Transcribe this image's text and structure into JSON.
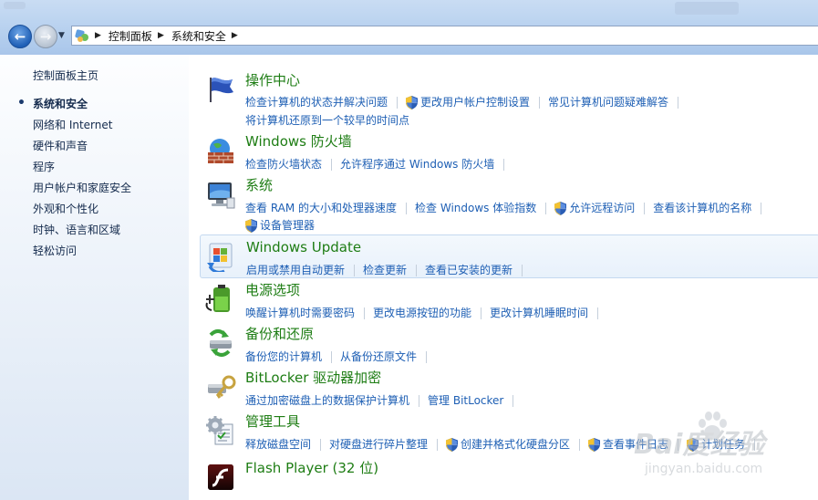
{
  "nav": {
    "back_icon": "back-arrow-icon",
    "forward_icon": "forward-arrow-icon",
    "breadcrumb": [
      "控制面板",
      "系统和安全"
    ]
  },
  "sidebar": {
    "home": "控制面板主页",
    "items": [
      {
        "label": "系统和安全",
        "current": true
      },
      {
        "label": "网络和 Internet"
      },
      {
        "label": "硬件和声音"
      },
      {
        "label": "程序"
      },
      {
        "label": "用户帐户和家庭安全"
      },
      {
        "label": "外观和个性化"
      },
      {
        "label": "时钟、语言和区域"
      },
      {
        "label": "轻松访问"
      }
    ]
  },
  "categories": [
    {
      "title": "操作中心",
      "icon": "flag-icon",
      "rows": [
        [
          {
            "text": "检查计算机的状态并解决问题"
          },
          {
            "text": "更改用户帐户控制设置",
            "shield": true
          },
          {
            "text": "常见计算机问题疑难解答"
          }
        ],
        [
          {
            "text": "将计算机还原到一个较早的时间点"
          }
        ]
      ]
    },
    {
      "title": "Windows 防火墙",
      "icon": "firewall-icon",
      "rows": [
        [
          {
            "text": "检查防火墙状态"
          },
          {
            "text": "允许程序通过 Windows 防火墙"
          }
        ]
      ]
    },
    {
      "title": "系统",
      "icon": "computer-icon",
      "rows": [
        [
          {
            "text": "查看 RAM 的大小和处理器速度"
          },
          {
            "text": "检查 Windows 体验指数"
          },
          {
            "text": "允许远程访问",
            "shield": true
          },
          {
            "text": "查看该计算机的名称"
          }
        ],
        [
          {
            "text": "设备管理器",
            "shield": true
          }
        ]
      ]
    },
    {
      "title": "Windows Update",
      "icon": "windows-update-icon",
      "highlighted": true,
      "rows": [
        [
          {
            "text": "启用或禁用自动更新"
          },
          {
            "text": "检查更新"
          },
          {
            "text": "查看已安装的更新"
          }
        ]
      ]
    },
    {
      "title": "电源选项",
      "icon": "power-battery-icon",
      "rows": [
        [
          {
            "text": "唤醒计算机时需要密码"
          },
          {
            "text": "更改电源按钮的功能"
          },
          {
            "text": "更改计算机睡眠时间"
          }
        ]
      ]
    },
    {
      "title": "备份和还原",
      "icon": "backup-icon",
      "rows": [
        [
          {
            "text": "备份您的计算机"
          },
          {
            "text": "从备份还原文件"
          }
        ]
      ]
    },
    {
      "title": "BitLocker 驱动器加密",
      "icon": "bitlocker-key-icon",
      "rows": [
        [
          {
            "text": "通过加密磁盘上的数据保护计算机"
          },
          {
            "text": "管理 BitLocker"
          }
        ]
      ]
    },
    {
      "title": "管理工具",
      "icon": "admin-tools-icon",
      "rows": [
        [
          {
            "text": "释放磁盘空间"
          },
          {
            "text": "对硬盘进行碎片整理"
          },
          {
            "text": "创建并格式化硬盘分区",
            "shield": true
          },
          {
            "text": "查看事件日志",
            "shield": true
          },
          {
            "text": "计划任务",
            "shield": true
          }
        ]
      ]
    },
    {
      "title": "Flash Player (32 位)",
      "icon": "flash-player-icon",
      "rows": []
    }
  ],
  "watermark": {
    "brand": "Bai度经验",
    "url": "jingyan.baidu.com"
  }
}
